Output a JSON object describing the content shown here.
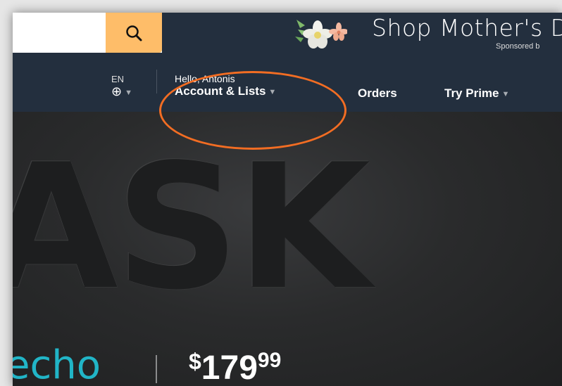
{
  "header": {
    "search_icon": "search-icon",
    "promo_text": "Shop Mother's D",
    "promo_sponsored": "Sponsored b"
  },
  "nav": {
    "lang_code": "EN",
    "globe_icon": "globe-icon",
    "greeting": "Hello, Antonis",
    "account_label": "Account & Lists",
    "orders_label": "Orders",
    "prime_label": "Try Prime"
  },
  "hero": {
    "headline": "ASK",
    "brand": "echo",
    "price_symbol": "$",
    "price_main": "179",
    "price_cents": "99"
  },
  "colors": {
    "nav_bg": "#232f3e",
    "search_accent": "#febd69",
    "highlight": "#f26d23",
    "echo_brand": "#21b5c7"
  }
}
